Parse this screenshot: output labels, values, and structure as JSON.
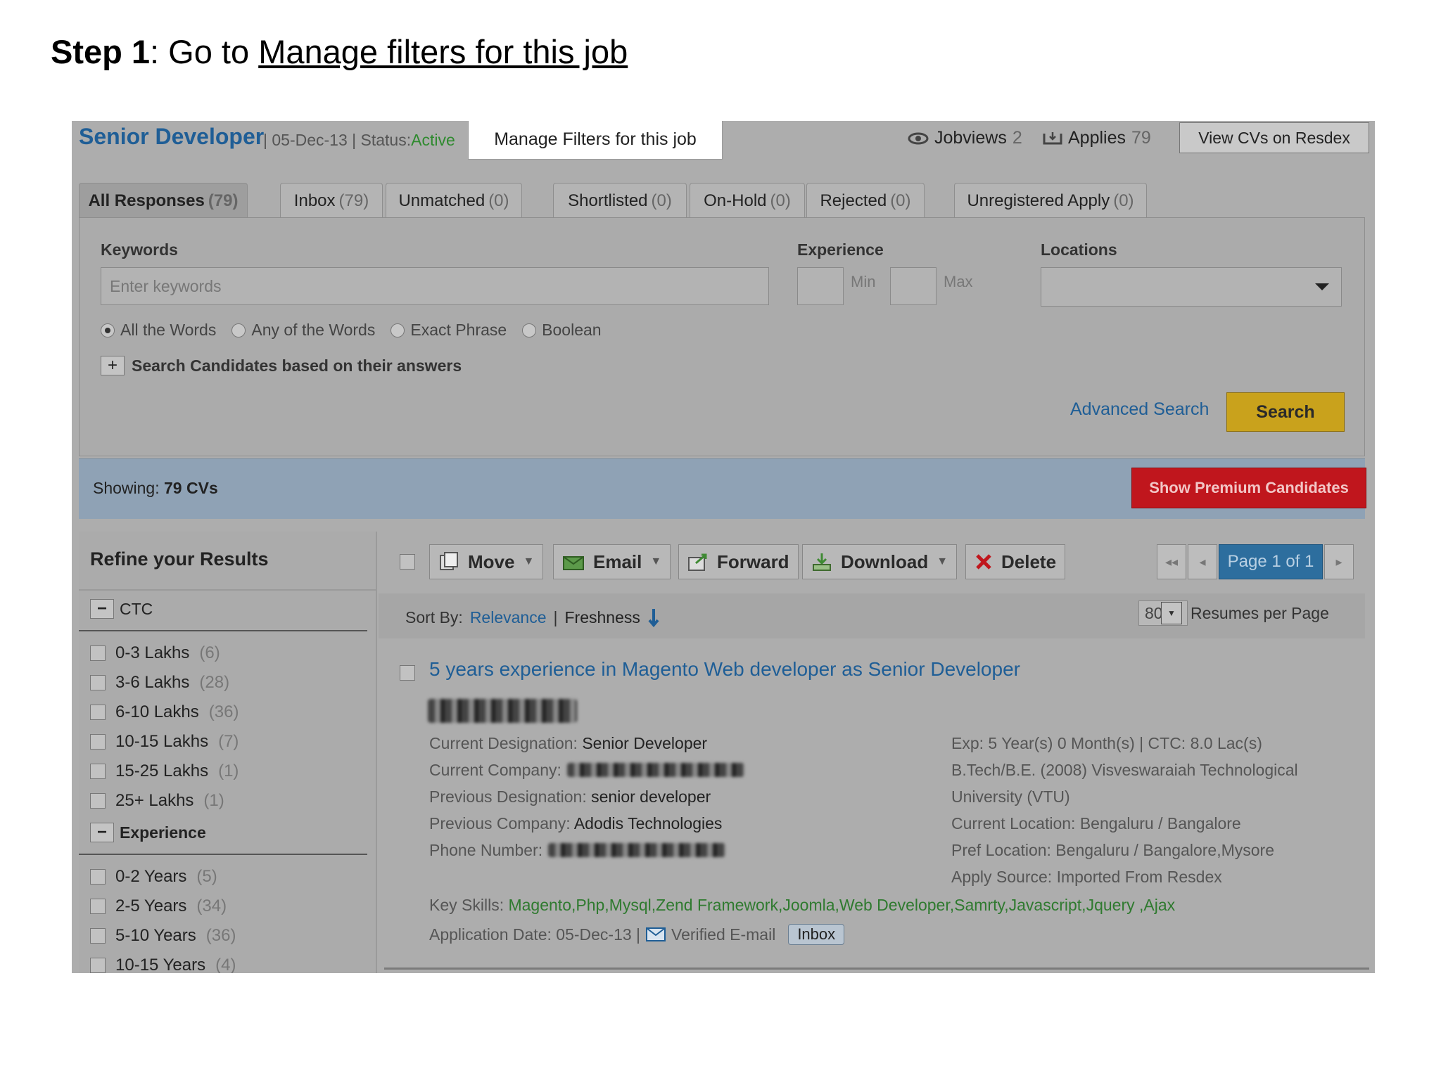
{
  "step": {
    "bold": "Step 1",
    "text": ": Go to ",
    "link": "Manage filters for this job"
  },
  "header": {
    "job_title": "Senior Developer",
    "meta_prefix": "| 05-Dec-13 | Status:",
    "status": "Active",
    "manage_button": "Manage Filters for this job",
    "jobviews_label": "Jobviews",
    "jobviews_count": "2",
    "applies_label": "Applies",
    "applies_count": "79",
    "view_cvs": "View CVs on Resdex"
  },
  "tabs": [
    {
      "label": "All Responses",
      "count": "(79)"
    },
    {
      "label": "Inbox",
      "count": "(79)"
    },
    {
      "label": "Unmatched",
      "count": "(0)"
    },
    {
      "label": "Shortlisted",
      "count": "(0)"
    },
    {
      "label": "On-Hold",
      "count": "(0)"
    },
    {
      "label": "Rejected",
      "count": "(0)"
    },
    {
      "label": "Unregistered Apply",
      "count": "(0)"
    }
  ],
  "search": {
    "keywords_label": "Keywords",
    "keywords_placeholder": "Enter keywords",
    "experience_label": "Experience",
    "min_label": "Min",
    "max_label": "Max",
    "locations_label": "Locations",
    "match_options": [
      "All the Words",
      "Any of the Words",
      "Exact Phrase",
      "Boolean"
    ],
    "answers_label": "Search Candidates based on their answers",
    "advanced_search": "Advanced Search",
    "search_button": "Search"
  },
  "showing": {
    "label": "Showing:",
    "value": "79 CVs",
    "premium_button": "Show Premium Candidates"
  },
  "sidebar": {
    "title": "Refine your Results",
    "ctc_label": "CTC",
    "ctc_items": [
      {
        "label": "0-3 Lakhs",
        "count": "(6)"
      },
      {
        "label": "3-6 Lakhs",
        "count": "(28)"
      },
      {
        "label": "6-10 Lakhs",
        "count": "(36)"
      },
      {
        "label": "10-15 Lakhs",
        "count": "(7)"
      },
      {
        "label": "15-25 Lakhs",
        "count": "(1)"
      },
      {
        "label": "25+ Lakhs",
        "count": "(1)"
      }
    ],
    "exp_label": "Experience",
    "exp_items": [
      {
        "label": "0-2 Years",
        "count": "(5)"
      },
      {
        "label": "2-5 Years",
        "count": "(34)"
      },
      {
        "label": "5-10 Years",
        "count": "(36)"
      },
      {
        "label": "10-15 Years",
        "count": "(4)"
      }
    ]
  },
  "toolbar": {
    "move": "Move",
    "email": "Email",
    "forward": "Forward",
    "download": "Download",
    "delete": "Delete",
    "page": "Page 1 of 1"
  },
  "sort": {
    "label": "Sort By:",
    "relevance": "Relevance",
    "separator": "|",
    "freshness": "Freshness",
    "per_page_value": "80",
    "per_page_label": "Resumes per Page"
  },
  "result": {
    "title": "5 years experience in Magento Web developer as Senior Developer",
    "left": [
      {
        "k": "Current Designation:",
        "v": "Senior Developer"
      },
      {
        "k": "Current Company:",
        "v": ""
      },
      {
        "k": "Previous Designation:",
        "v": "senior developer"
      },
      {
        "k": "Previous Company:",
        "v": "Adodis Technologies"
      },
      {
        "k": "Phone Number:",
        "v": ""
      }
    ],
    "right": [
      "Exp: 5 Year(s) 0 Month(s) | CTC: 8.0 Lac(s)",
      "B.Tech/B.E. (2008)  Visveswaraiah Technological",
      "University (VTU)",
      "Current Location: Bengaluru / Bangalore",
      "Pref Location: Bengaluru / Bangalore,Mysore",
      "Apply Source: Imported From Resdex"
    ],
    "skills_label": "Key Skills:",
    "skills": "Magento,Php,Mysql,Zend Framework,Joomla,Web Developer,Samrty,Javascript,Jquery ,Ajax",
    "app_date": "Application Date: 05-Dec-13 |",
    "verified": "Verified E-mail",
    "inbox_tag": "Inbox"
  }
}
